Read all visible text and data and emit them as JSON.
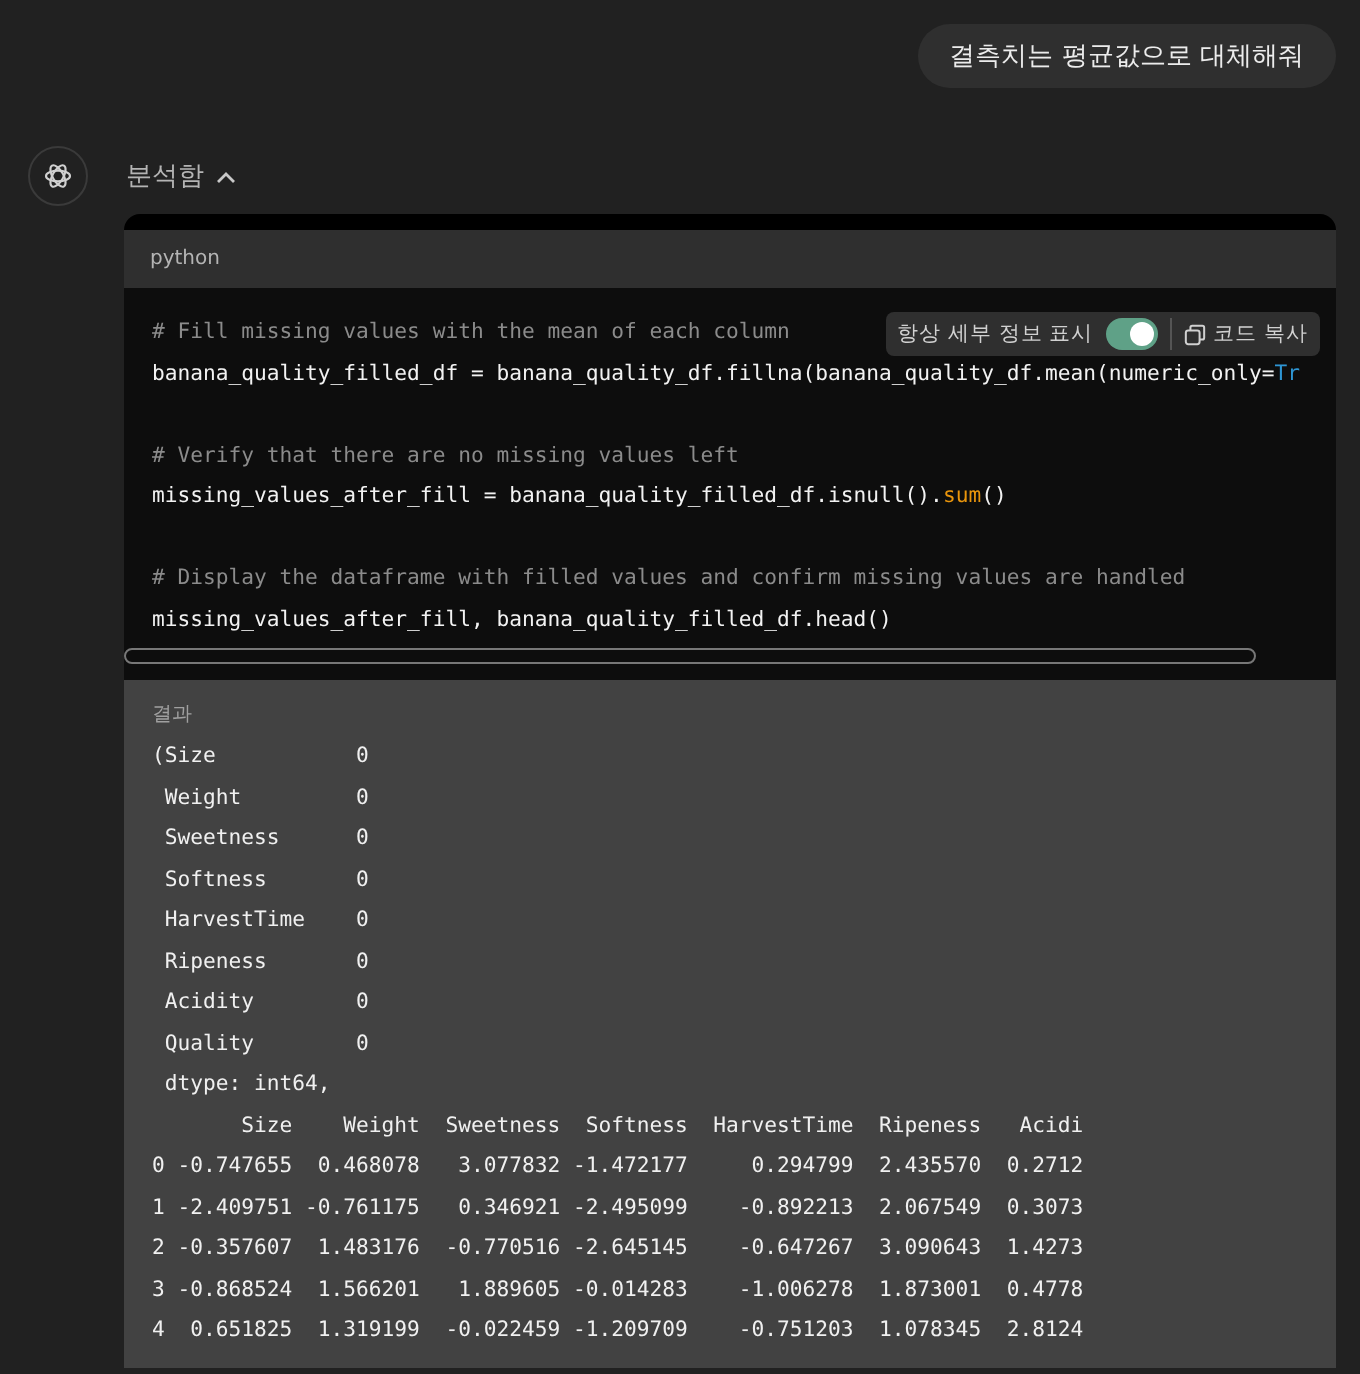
{
  "user_message": "결측치는 평균값으로 대체해줘",
  "assistant": {
    "status": "분석함",
    "expanded": true
  },
  "code_block": {
    "language": "python",
    "toolbar": {
      "details_label": "항상 세부 정보 표시",
      "details_on": true,
      "copy_label": "코드 복사"
    },
    "blocks": [
      [
        [
          {
            "kind": "comment",
            "text": "# Fill missing values with the mean of each column"
          }
        ],
        [
          {
            "kind": "plain",
            "text": "banana_quality_filled_df = banana_quality_df.fillna(banana_quality_df.mean(numeric_only="
          },
          {
            "kind": "literal",
            "text": "Tr"
          }
        ]
      ],
      [
        [
          {
            "kind": "comment",
            "text": "# Verify that there are no missing values left"
          }
        ],
        [
          {
            "kind": "plain",
            "text": "missing_values_after_fill = banana_quality_filled_df.isnull()."
          },
          {
            "kind": "call",
            "text": "sum"
          },
          {
            "kind": "plain",
            "text": "()"
          }
        ]
      ],
      [
        [
          {
            "kind": "comment",
            "text": "# Display the dataframe with filled values and confirm missing values are handled"
          }
        ],
        [
          {
            "kind": "plain",
            "text": "missing_values_after_fill, banana_quality_filled_df.head()"
          }
        ]
      ]
    ]
  },
  "output": {
    "label": "결과",
    "lines": [
      "(Size           0",
      " Weight         0",
      " Sweetness      0",
      " Softness       0",
      " HarvestTime    0",
      " Ripeness       0",
      " Acidity        0",
      " Quality        0",
      " dtype: int64,",
      "       Size    Weight  Sweetness  Softness  HarvestTime  Ripeness   Acidi",
      "0 -0.747655  0.468078   3.077832 -1.472177     0.294799  2.435570  0.2712",
      "1 -2.409751 -0.761175   0.346921 -2.495099    -0.892213  2.067549  0.3073",
      "2 -0.357607  1.483176  -0.770516 -2.645145    -0.647267  3.090643  1.4273",
      "3 -0.868524  1.566201   1.889605 -0.014283    -1.006278  1.873001  0.4778",
      "4  0.651825  1.319199  -0.022459 -1.209709    -0.751203  1.078345  2.8124"
    ]
  }
}
